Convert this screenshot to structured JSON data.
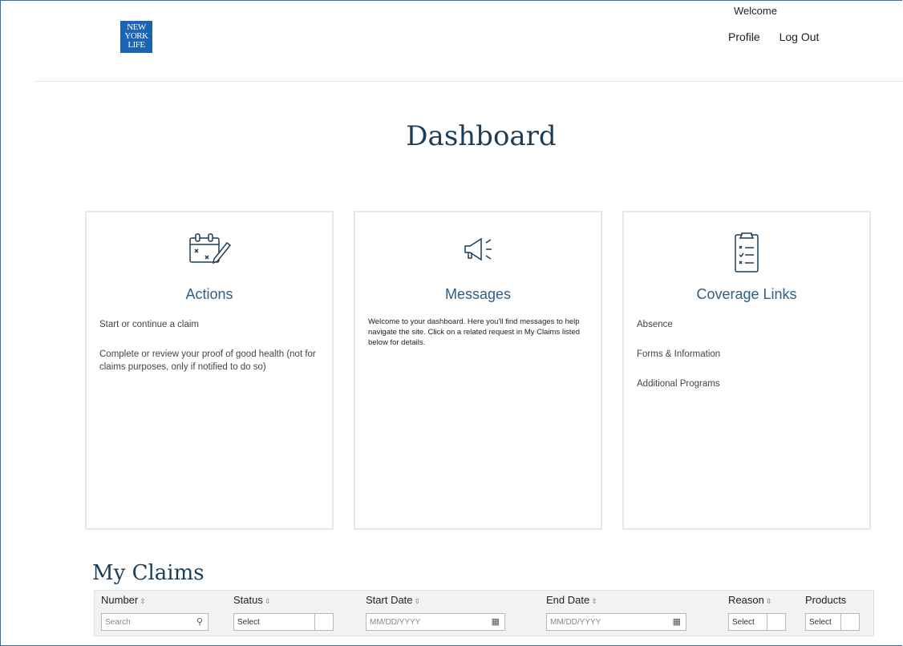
{
  "header": {
    "logo_lines": [
      "NEW",
      "YORK",
      "LIFE"
    ],
    "welcome": "Welcome",
    "nav": [
      "Profile",
      "Log Out"
    ]
  },
  "page_title": "Dashboard",
  "cards": {
    "actions": {
      "title": "Actions",
      "links": [
        "Start or continue a claim",
        "Complete or review your proof of good health (not for claims purposes, only if notified to do so)"
      ]
    },
    "messages": {
      "title": "Messages",
      "text": "Welcome to your dashboard. Here you'll find messages to help navigate the site. Click on a related request in My Claims listed below for details."
    },
    "coverage": {
      "title": "Coverage Links",
      "links": [
        "Absence",
        "Forms & Information",
        "Additional Programs"
      ]
    }
  },
  "claims": {
    "title": "My Claims",
    "columns": [
      {
        "label": "Number",
        "filter_placeholder": "Search"
      },
      {
        "label": "Status",
        "filter_value": "Select"
      },
      {
        "label": "Start Date",
        "filter_placeholder": "MM/DD/YYYY"
      },
      {
        "label": "End Date",
        "filter_placeholder": "MM/DD/YYYY"
      },
      {
        "label": "Reason",
        "filter_value": "Select"
      },
      {
        "label": "Products",
        "filter_value": "Select"
      }
    ]
  },
  "colors": {
    "brand_blue": "#1b63b3",
    "heading": "#1c3d5a",
    "card_title": "#2e5f86",
    "card_border": "#dfe9f2"
  },
  "icons": [
    "calendar-pencil-icon",
    "megaphone-icon",
    "clipboard-checklist-icon",
    "search-icon",
    "calendar-icon",
    "sort-icon"
  ]
}
